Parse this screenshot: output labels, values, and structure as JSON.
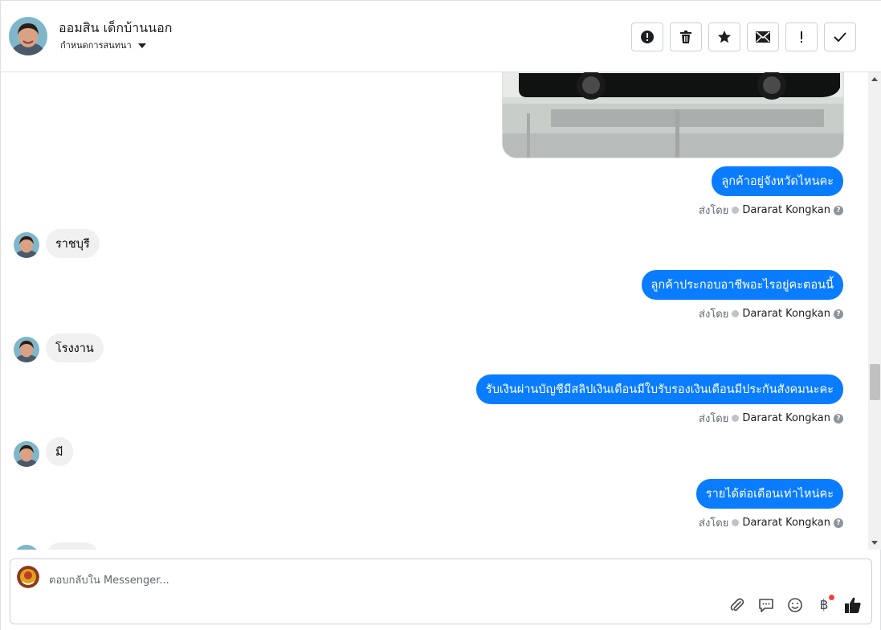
{
  "header": {
    "contact_name": "ออมสิน เด็กบ้านนอก",
    "assign_label": "กำหนดการสนทนา",
    "actions": [
      "mark-spam",
      "delete",
      "star",
      "mark-unread",
      "follow-up",
      "mark-done"
    ]
  },
  "messages": [
    {
      "dir": "out",
      "text": "ลูกค้าอยู่จังหวัดไหนคะ",
      "sent_prefix": "ส่งโดย",
      "sender": "Dararat Kongkan"
    },
    {
      "dir": "in",
      "text": "ราชบุรี"
    },
    {
      "dir": "out",
      "text": "ลูกค้าประกอบอาชีพอะไรอยู่คะตอนนี้",
      "sent_prefix": "ส่งโดย",
      "sender": "Dararat Kongkan"
    },
    {
      "dir": "in",
      "text": "โรงงาน"
    },
    {
      "dir": "out",
      "text": "รับเงินผ่านบัญชีมีสลิปเงินเดือนมีใบรับรองเงินเดือนมีประกันสังคมนะคะ",
      "sent_prefix": "ส่งโดย",
      "sender": "Dararat Kongkan"
    },
    {
      "dir": "in",
      "text": "มี"
    },
    {
      "dir": "out",
      "text": "รายได้ต่อเดือนเท่าไหน่คะ",
      "sent_prefix": "ส่งโดย",
      "sender": "Dararat Kongkan"
    }
  ],
  "composer": {
    "placeholder": "ตอบกลับใน Messenger..."
  },
  "colors": {
    "outgoing_bubble": "#0a7cff",
    "incoming_bubble": "#f0f0f0",
    "notification_dot": "#fa3e3e"
  }
}
